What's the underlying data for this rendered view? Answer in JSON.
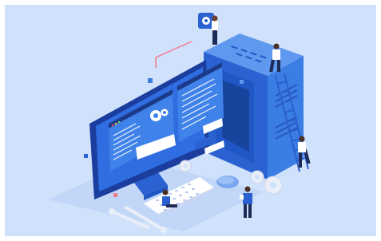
{
  "scene": {
    "description_tags": [
      "isometric-illustration",
      "server-maintenance",
      "developer-team"
    ],
    "colors": {
      "frame": "#ffffff",
      "background": "#cfe1fb",
      "server_main": "#3b7ee3",
      "server_dark": "#1f57c4",
      "server_side": "#2a63d1",
      "monitor_frame": "#1a3d9e",
      "screen": "#2f6de0",
      "screen_panel": "#3f82ea",
      "window_header": "#1b3a8a",
      "text_lines": "#ffffff",
      "accent_pink": "#f07b8f",
      "accent_red": "#e84c4c",
      "gear": "#e9eef8",
      "keyboard": "#ffffff",
      "mouse": "#7aa7ef",
      "people_dark": "#1c2a55",
      "people_shirt": "#ffffff",
      "shadow": "#a8c2ef"
    },
    "icons": [
      "gear-icon",
      "settings-badge-icon",
      "wrench-icon",
      "ladder-icon",
      "mouse-icon",
      "keyboard-icon"
    ]
  }
}
